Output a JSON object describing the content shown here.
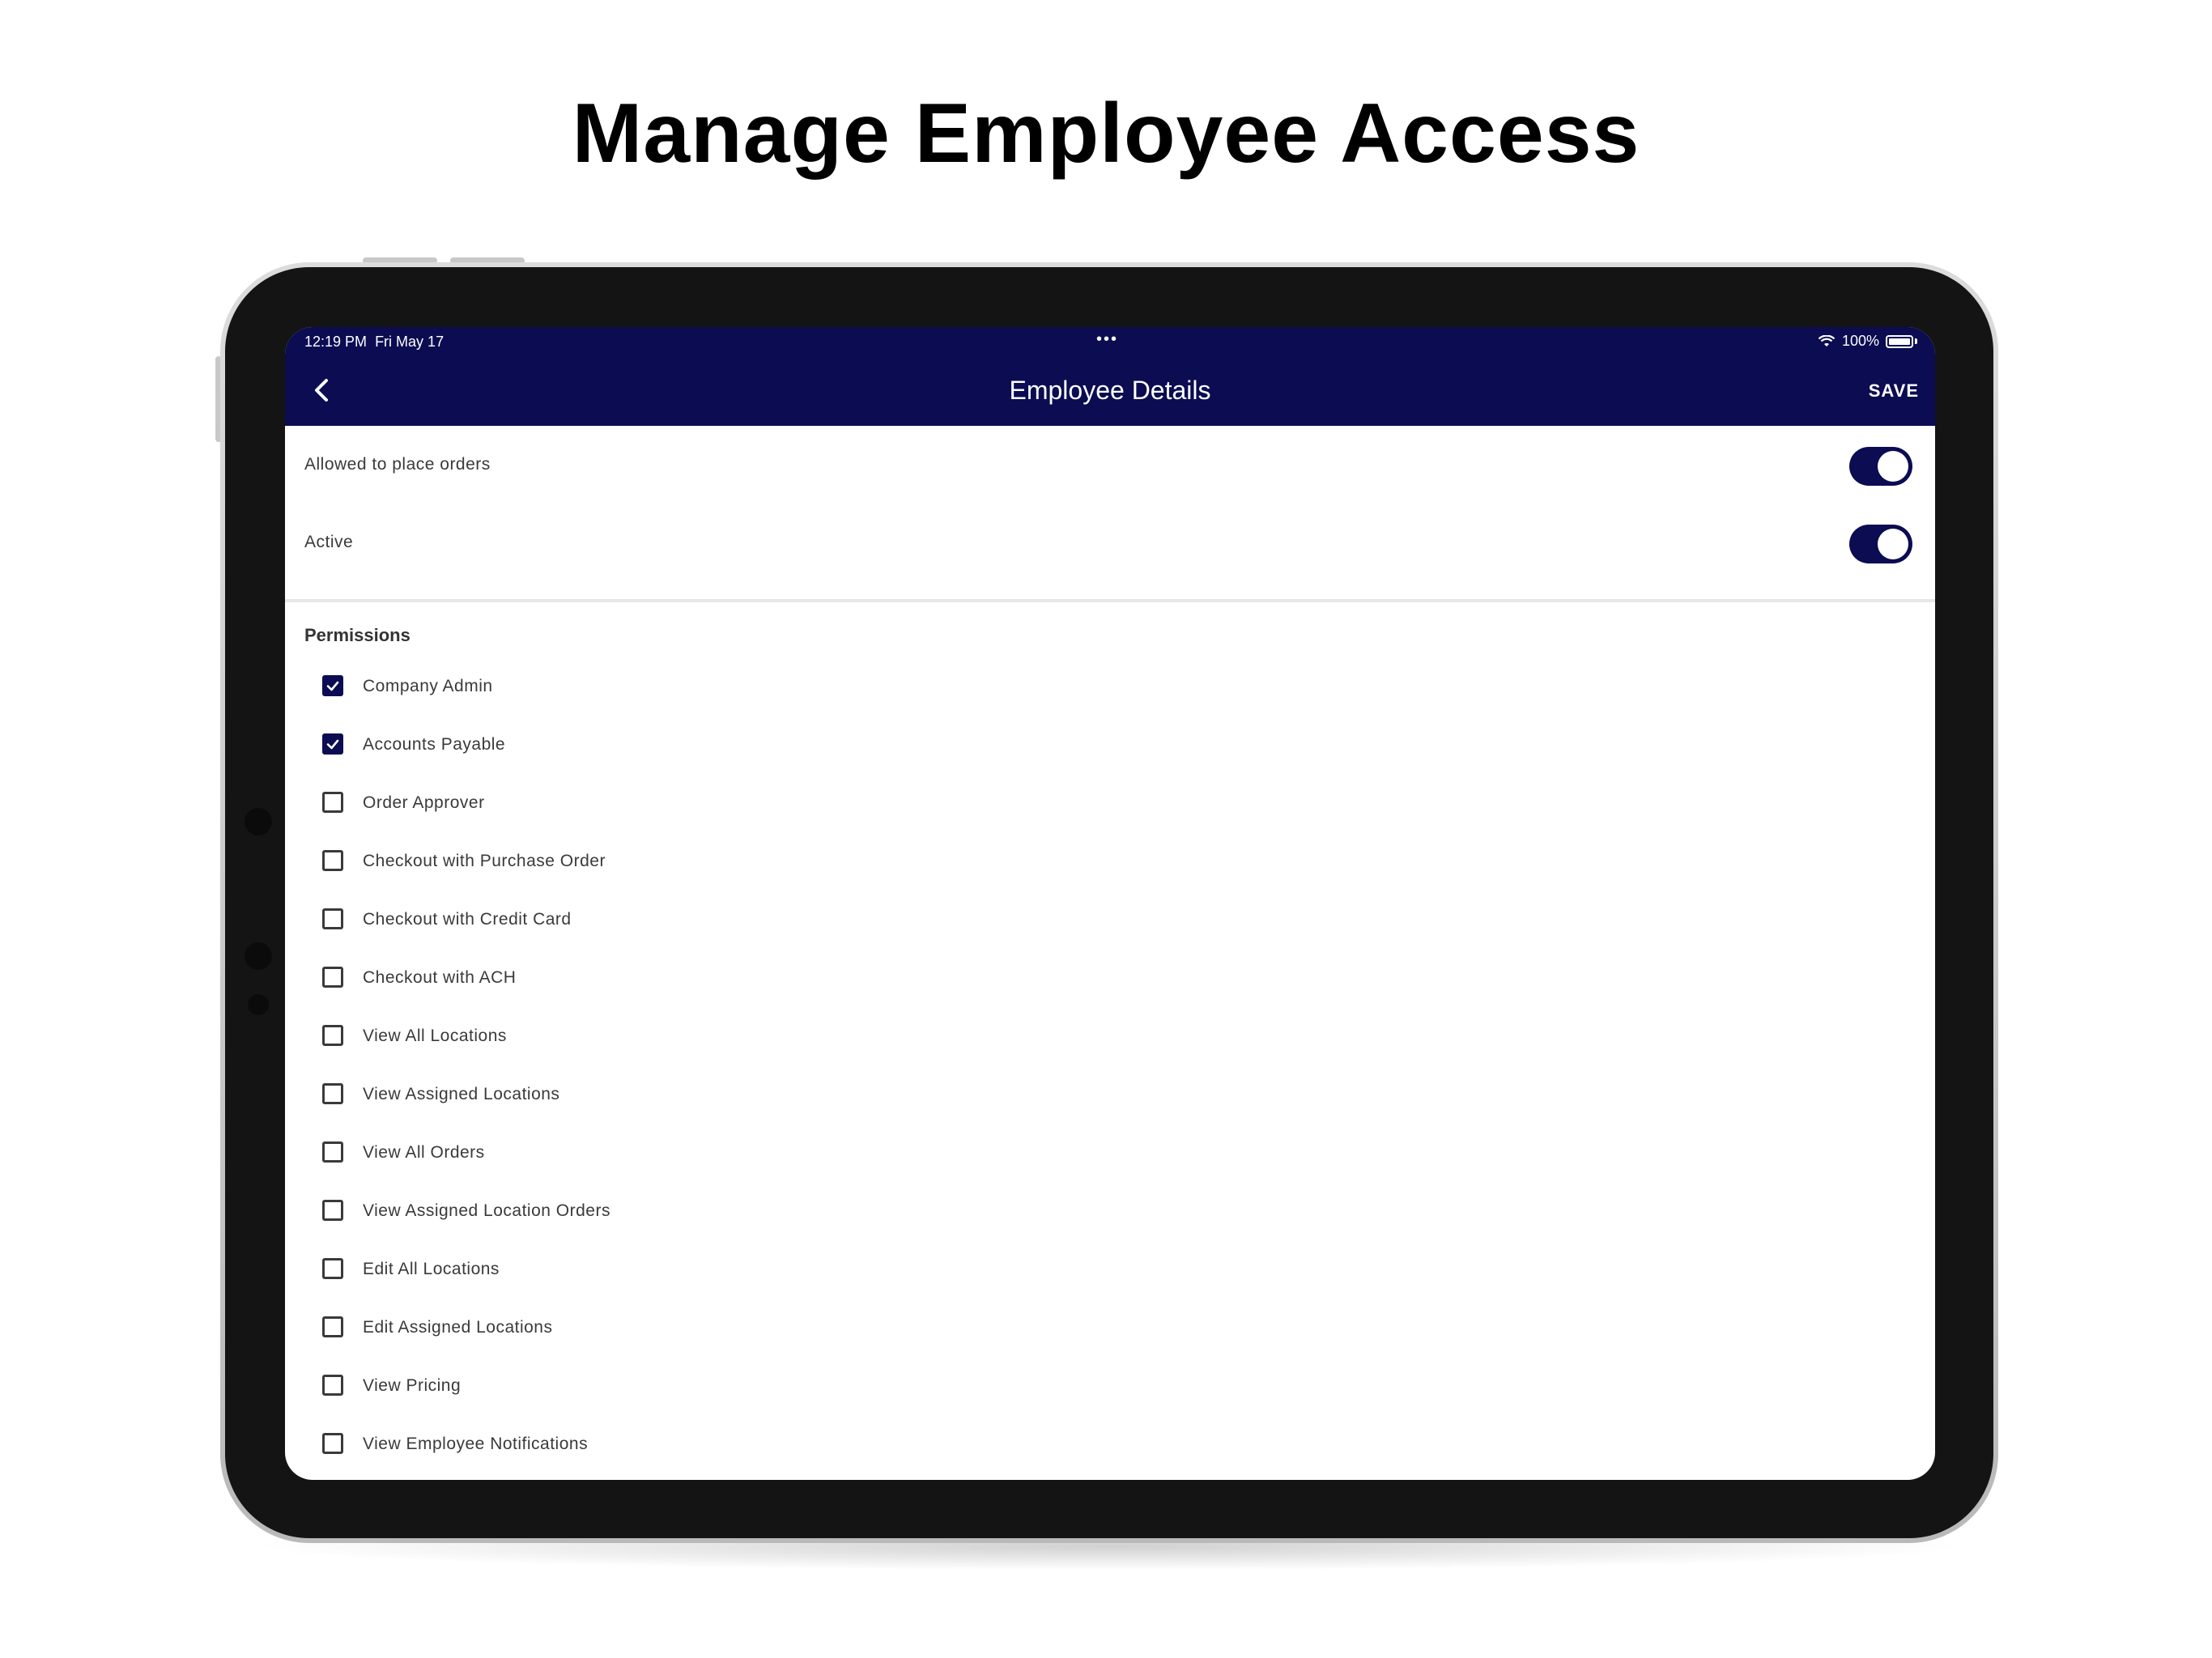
{
  "headline": "Manage Employee Access",
  "status_bar": {
    "time": "12:19 PM",
    "date": "Fri May 17",
    "dots": "•••",
    "battery": "100%"
  },
  "nav": {
    "title": "Employee Details",
    "save_label": "SAVE"
  },
  "toggles": [
    {
      "label": "Allowed to place orders",
      "on": true
    },
    {
      "label": "Active",
      "on": true
    }
  ],
  "permissions": {
    "title": "Permissions",
    "items": [
      {
        "label": "Company Admin",
        "checked": true
      },
      {
        "label": "Accounts Payable",
        "checked": true
      },
      {
        "label": "Order Approver",
        "checked": false
      },
      {
        "label": "Checkout with Purchase Order",
        "checked": false
      },
      {
        "label": "Checkout with Credit Card",
        "checked": false
      },
      {
        "label": "Checkout with ACH",
        "checked": false
      },
      {
        "label": "View All Locations",
        "checked": false
      },
      {
        "label": "View Assigned Locations",
        "checked": false
      },
      {
        "label": "View All Orders",
        "checked": false
      },
      {
        "label": "View Assigned Location Orders",
        "checked": false
      },
      {
        "label": "Edit All Locations",
        "checked": false
      },
      {
        "label": "Edit Assigned Locations",
        "checked": false
      },
      {
        "label": "View Pricing",
        "checked": false
      },
      {
        "label": "View Employee Notifications",
        "checked": false
      }
    ]
  },
  "colors": {
    "accent": "#0b0c52",
    "background": "#ffffff",
    "text": "#3a3a3a"
  },
  "icons": {
    "back": "chevron-left-icon",
    "wifi": "wifi-icon",
    "battery": "battery-icon",
    "check": "checkmark-icon"
  }
}
